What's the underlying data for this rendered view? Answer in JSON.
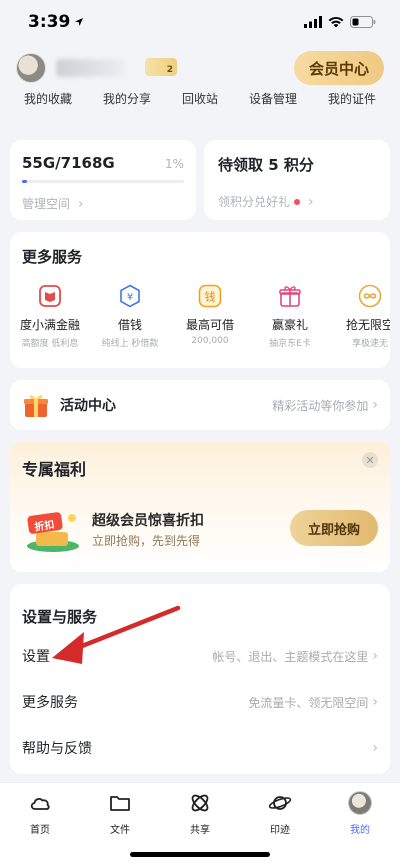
{
  "status": {
    "time": "3:39"
  },
  "profile": {
    "level": "2",
    "vip_button": "会员中心"
  },
  "quick_nav": [
    "我的收藏",
    "我的分享",
    "回收站",
    "设备管理",
    "我的证件"
  ],
  "storage": {
    "used": "55G/7168G",
    "percent": "1%",
    "link": "管理空间",
    "fill_fraction": 0.03
  },
  "points": {
    "title": "待领取 5 积分",
    "link": "领积分兑好礼"
  },
  "services": {
    "title": "更多服务",
    "items": [
      {
        "label": "度小满金融",
        "sub": "高额度 低利息",
        "icon": "book-icon"
      },
      {
        "label": "借钱",
        "sub": "纯线上  秒借款",
        "icon": "yuan-icon"
      },
      {
        "label": "最高可借",
        "sub": "200,000",
        "icon": "money-icon"
      },
      {
        "label": "赢豪礼",
        "sub": "抽京东E卡",
        "icon": "gift-icon"
      },
      {
        "label": "抢无限空",
        "sub": "享极速无",
        "icon": "infinity-icon"
      }
    ]
  },
  "activity": {
    "title": "活动中心",
    "hint": "精彩活动等你参加"
  },
  "benefit": {
    "title": "专属福利",
    "discount_tag": "折扣",
    "main": "超级会员惊喜折扣",
    "sub": "立即抢购，先到先得",
    "button": "立即抢购"
  },
  "settings": {
    "title": "设置与服务",
    "rows": [
      {
        "label": "设置",
        "hint": "帐号、退出、主题模式在这里"
      },
      {
        "label": "更多服务",
        "hint": "免流量卡、领无限空间"
      },
      {
        "label": "帮助与反馈",
        "hint": ""
      }
    ]
  },
  "tabs": [
    "首页",
    "文件",
    "共享",
    "印迹",
    "我的"
  ],
  "colors": {
    "accent_blue": "#4b6ef5",
    "gold": "#efc981",
    "red_arrow": "#d42a2a",
    "active_tab": "#4b6ef5"
  }
}
